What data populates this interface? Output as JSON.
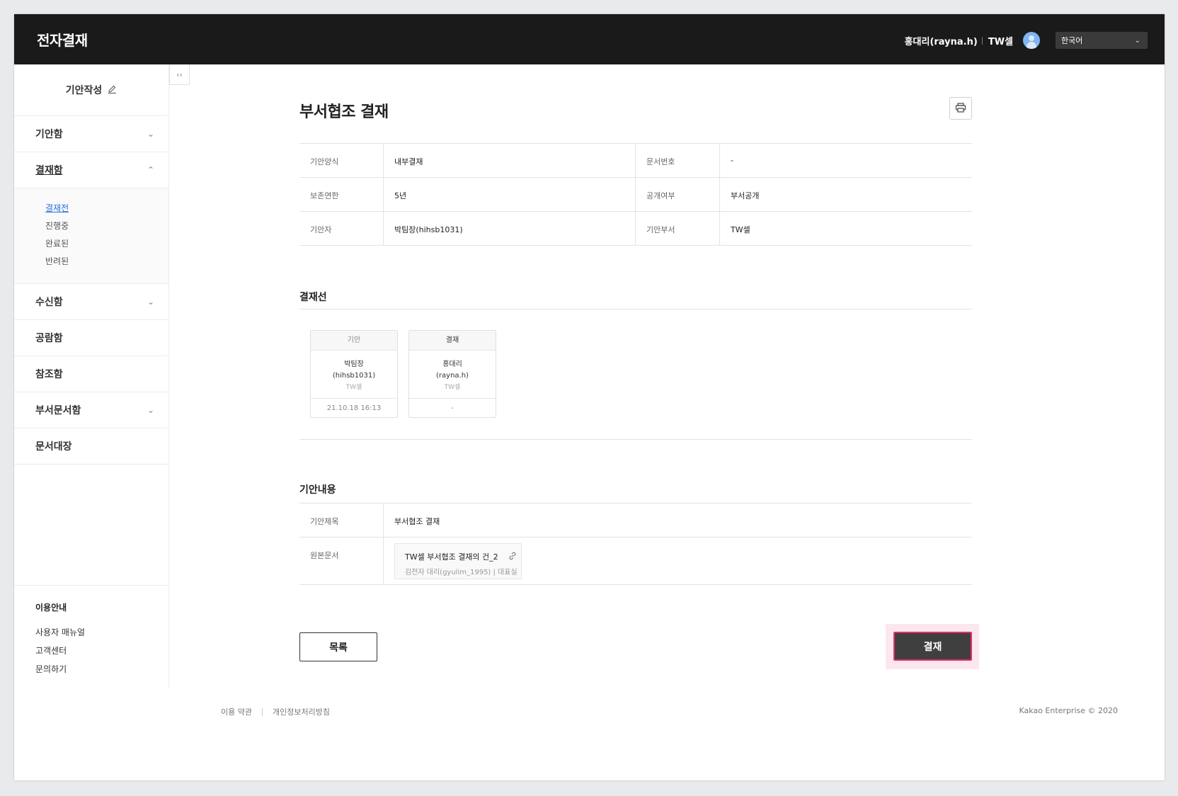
{
  "header": {
    "app_title": "전자결재",
    "user_name": "홍대리(rayna.h)",
    "user_team": "TW셀",
    "language": "한국어"
  },
  "sidebar": {
    "compose_label": "기안작성",
    "items": [
      {
        "label": "기안함",
        "expandable": true
      },
      {
        "label": "결재함",
        "expandable": true,
        "open": true
      },
      {
        "label": "수신함",
        "expandable": true
      },
      {
        "label": "공람함",
        "expandable": false
      },
      {
        "label": "참조함",
        "expandable": false
      },
      {
        "label": "부서문서함",
        "expandable": true
      },
      {
        "label": "문서대장",
        "expandable": false
      }
    ],
    "submenu": [
      "결재전",
      "진행중",
      "완료된",
      "반려된"
    ],
    "help": {
      "title": "이용안내",
      "links": [
        "사용자 매뉴얼",
        "고객센터",
        "문의하기"
      ]
    }
  },
  "main": {
    "title": "부서협조 결재",
    "info_rows": [
      {
        "label1": "기안양식",
        "value1": "내부결재",
        "label2": "문서번호",
        "value2": "-"
      },
      {
        "label1": "보존연한",
        "value1": "5년",
        "label2": "공개여부",
        "value2": "부서공개"
      },
      {
        "label1": "기안자",
        "value1": "박팀장(hihsb1031)",
        "label2": "기안부서",
        "value2": "TW셀"
      }
    ],
    "approval_section_title": "결재선",
    "approvers": [
      {
        "role": "기안",
        "name": "박팀장",
        "id": "(hihsb1031)",
        "team": "TW셀",
        "date": "21.10.18 16:13"
      },
      {
        "role": "결재",
        "name": "홍대리",
        "id": "(rayna.h)",
        "team": "TW셀",
        "date": "-"
      }
    ],
    "content_section_title": "기안내용",
    "content_rows": {
      "subject_label": "기안제목",
      "subject_value": "부서협조 결재",
      "origin_label": "원본문서",
      "origin_doc_title": "TW셀 부서협조 결재의 건_2",
      "origin_doc_meta": "김전자 대리(gyulim_1995) | 대표실"
    },
    "list_button": "목록",
    "approve_button": "결재"
  },
  "footer": {
    "terms": "이용 약관",
    "privacy": "개인정보처리방침",
    "copyright": "Kakao Enterprise © 2020"
  }
}
